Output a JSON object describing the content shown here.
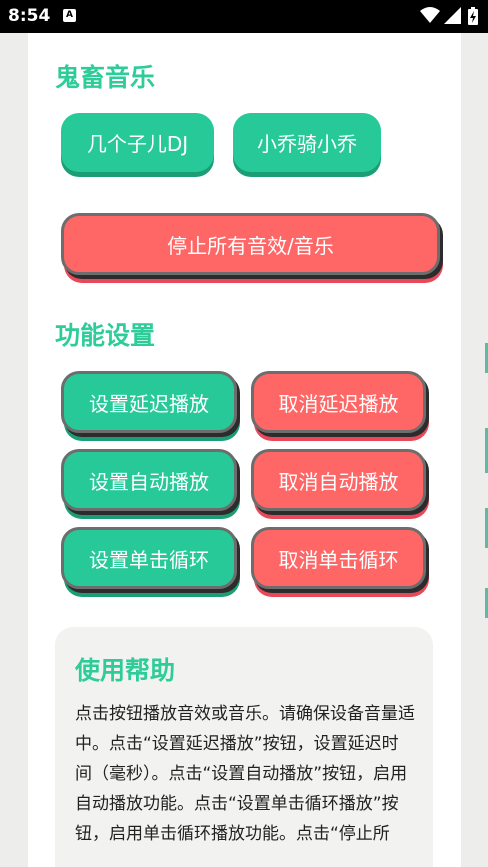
{
  "status_bar": {
    "time": "8:54",
    "notification_icon": "A"
  },
  "music_section": {
    "title": "鬼畜音乐",
    "buttons": [
      "几个子儿DJ",
      "小乔骑小乔"
    ],
    "stop_all": "停止所有音效/音乐"
  },
  "function_section": {
    "title": "功能设置",
    "set_delay": "设置延迟播放",
    "cancel_delay": "取消延迟播放",
    "set_auto": "设置自动播放",
    "cancel_auto": "取消自动播放",
    "set_loop": "设置单击循环",
    "cancel_loop": "取消单击循环"
  },
  "help": {
    "title": "使用帮助",
    "text": "点击按钮播放音效或音乐。请确保设备音量适中。点击“设置延迟播放”按钮，设置延迟时间（毫秒）。点击“设置自动播放”按钮，启用自动播放功能。点击“设置单击循环播放”按钮，启用单击循环播放功能。点击“停止所"
  },
  "colors": {
    "accent_green": "#26c997",
    "title_green": "#2ecc99",
    "danger_red": "#ff6666"
  }
}
